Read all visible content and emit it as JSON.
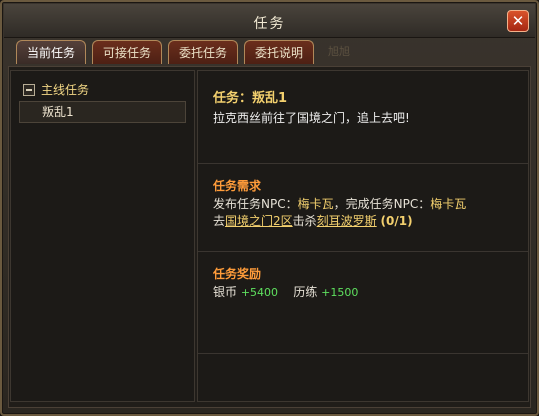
{
  "window": {
    "title": "任务"
  },
  "tabs": [
    {
      "label": "当前任务"
    },
    {
      "label": "可接任务"
    },
    {
      "label": "委托任务"
    },
    {
      "label": "委托说明"
    }
  ],
  "ghost_text": "旭旭",
  "quest_tree": {
    "group_label": "主线任务",
    "items": [
      {
        "label": "叛乱1"
      }
    ]
  },
  "quest_detail": {
    "name": "任务：叛乱1",
    "description": "拉克西丝前往了国境之门，追上去吧!",
    "requirements": {
      "title": "任务需求",
      "line1_prefix": "发布任务NPC：",
      "line1_npc1": "梅卡瓦",
      "line1_mid": "，完成任务NPC：",
      "line1_npc2": "梅卡瓦",
      "line2_prefix": "去",
      "line2_location": "国境之门2区",
      "line2_mid": "击杀",
      "line2_target": "刻耳波罗斯",
      "line2_progress": "(0/1)"
    },
    "rewards": {
      "title": "任务奖励",
      "silver_label": "银币",
      "silver_value": "+5400",
      "exp_label": "历练",
      "exp_value": "+1500"
    }
  }
}
